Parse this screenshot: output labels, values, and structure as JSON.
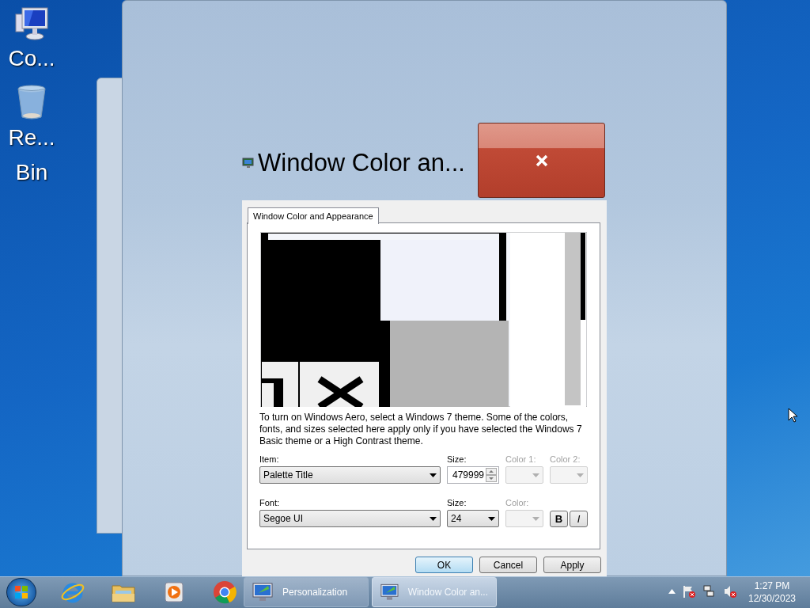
{
  "desktop_icons": [
    {
      "kind": "computer",
      "lines": [
        "Co..."
      ]
    },
    {
      "kind": "bin",
      "lines": [
        "Re...",
        "Bin"
      ]
    }
  ],
  "window": {
    "title": "Window Color an..."
  },
  "dialog": {
    "tabs": [
      {
        "label": "Window Color and Appearance",
        "selected": true
      }
    ],
    "description": "To turn on Windows Aero, select a Windows 7 theme.  Some of the colors, fonts, and sizes selected here apply only if you have selected the Windows 7 Basic theme or a High Contrast theme.",
    "rows": [
      [
        {
          "kind": "combo",
          "label": "Item:",
          "value": "Palette Title",
          "disabled": false
        },
        {
          "kind": "spin",
          "label": "Size:",
          "value": "479999",
          "disabled": false
        },
        {
          "kind": "combo",
          "label": "Color 1:",
          "disabled": true
        },
        {
          "kind": "combo",
          "label": "Color 2:",
          "disabled": true
        }
      ],
      [
        {
          "kind": "combo",
          "label": "Font:",
          "value": "Segoe UI",
          "disabled": false
        },
        {
          "kind": "combo",
          "label": "Size:",
          "value": "24",
          "disabled": false
        },
        {
          "kind": "combo",
          "label": "Color:",
          "disabled": true
        },
        {
          "kind": "toggle",
          "value": "B",
          "bold": true
        },
        {
          "kind": "toggle",
          "value": "I",
          "italic": true
        }
      ]
    ],
    "buttons": [
      {
        "label": "OK",
        "default": true
      },
      {
        "label": "Cancel",
        "default": false
      },
      {
        "label": "Apply",
        "default": false
      }
    ]
  },
  "taskbar": {
    "pinned": [
      {
        "kind": "ie"
      },
      {
        "kind": "folder"
      },
      {
        "kind": "media"
      },
      {
        "kind": "chrome"
      }
    ],
    "tasks": [
      {
        "label": "Personalization",
        "selected": false
      },
      {
        "label": "Window Color an...",
        "selected": true
      }
    ],
    "clock": {
      "time": "1:27 PM",
      "date": "12/30/2023"
    }
  }
}
